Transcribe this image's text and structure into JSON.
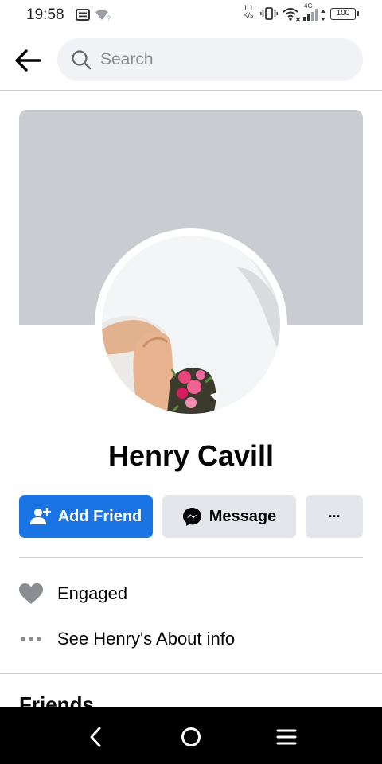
{
  "status_bar": {
    "time": "19:58",
    "net_speed_value": "1.1",
    "net_speed_unit": "K/s",
    "network_type": "4G",
    "battery_level": "100"
  },
  "search": {
    "placeholder": "Search"
  },
  "profile": {
    "name": "Henry Cavill"
  },
  "actions": {
    "add_friend_label": "Add Friend",
    "message_label": "Message",
    "more_label": "···"
  },
  "info": {
    "relationship": "Engaged",
    "about_link": "See Henry's About info"
  },
  "sections": {
    "friends_heading": "Friends"
  },
  "colors": {
    "accent": "#1b74e4",
    "cover": "#c9ccd1",
    "secondary_button": "#e4e6eb",
    "search_bg": "#f0f2f5"
  },
  "icons": {
    "back": "arrow-left-icon",
    "search": "magnifier-icon",
    "add_friend": "person-plus-icon",
    "message": "messenger-icon",
    "relationship": "heart-icon",
    "about": "ellipsis-icon",
    "nav_back": "chevron-left-icon",
    "nav_home": "circle-icon",
    "nav_menu": "hamburger-icon"
  }
}
